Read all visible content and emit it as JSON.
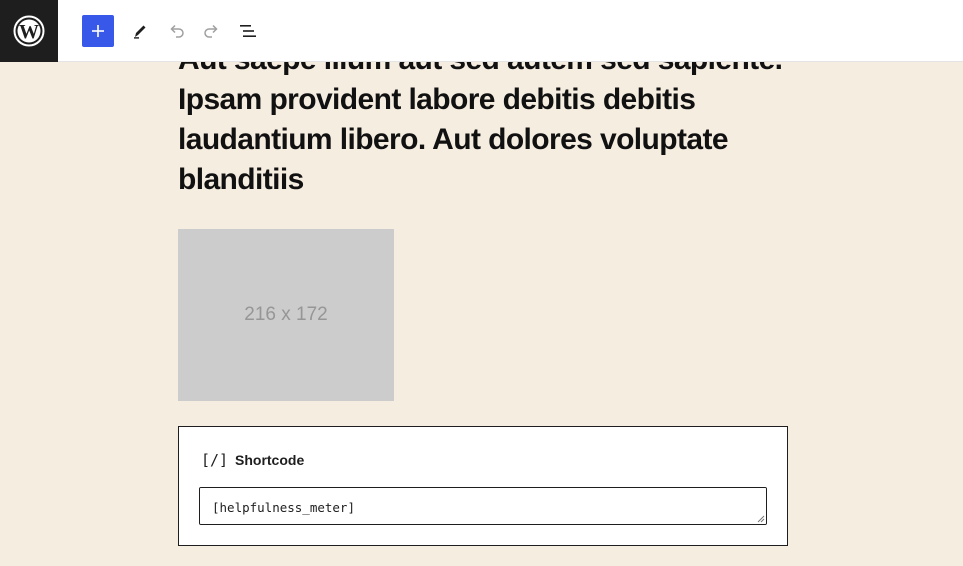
{
  "toolbar": {
    "logo_icon": "wordpress-icon",
    "add_icon": "plus-icon",
    "tools_icon": "pencil-icon",
    "undo_icon": "undo-icon",
    "redo_icon": "redo-icon",
    "list_view_icon": "list-view-icon",
    "accent_color": "#3858e9"
  },
  "content": {
    "heading": "Aut saepe illum aut sed autem sed sapiente. Ipsam provident labore debitis debitis laudantium libero. Aut dolores voluptate blanditiis",
    "image_placeholder_text": "216 x 172",
    "background_color": "#f6ede1"
  },
  "shortcode_block": {
    "icon_text": "[/]",
    "label": "Shortcode",
    "value": "[helpfulness_meter]"
  }
}
